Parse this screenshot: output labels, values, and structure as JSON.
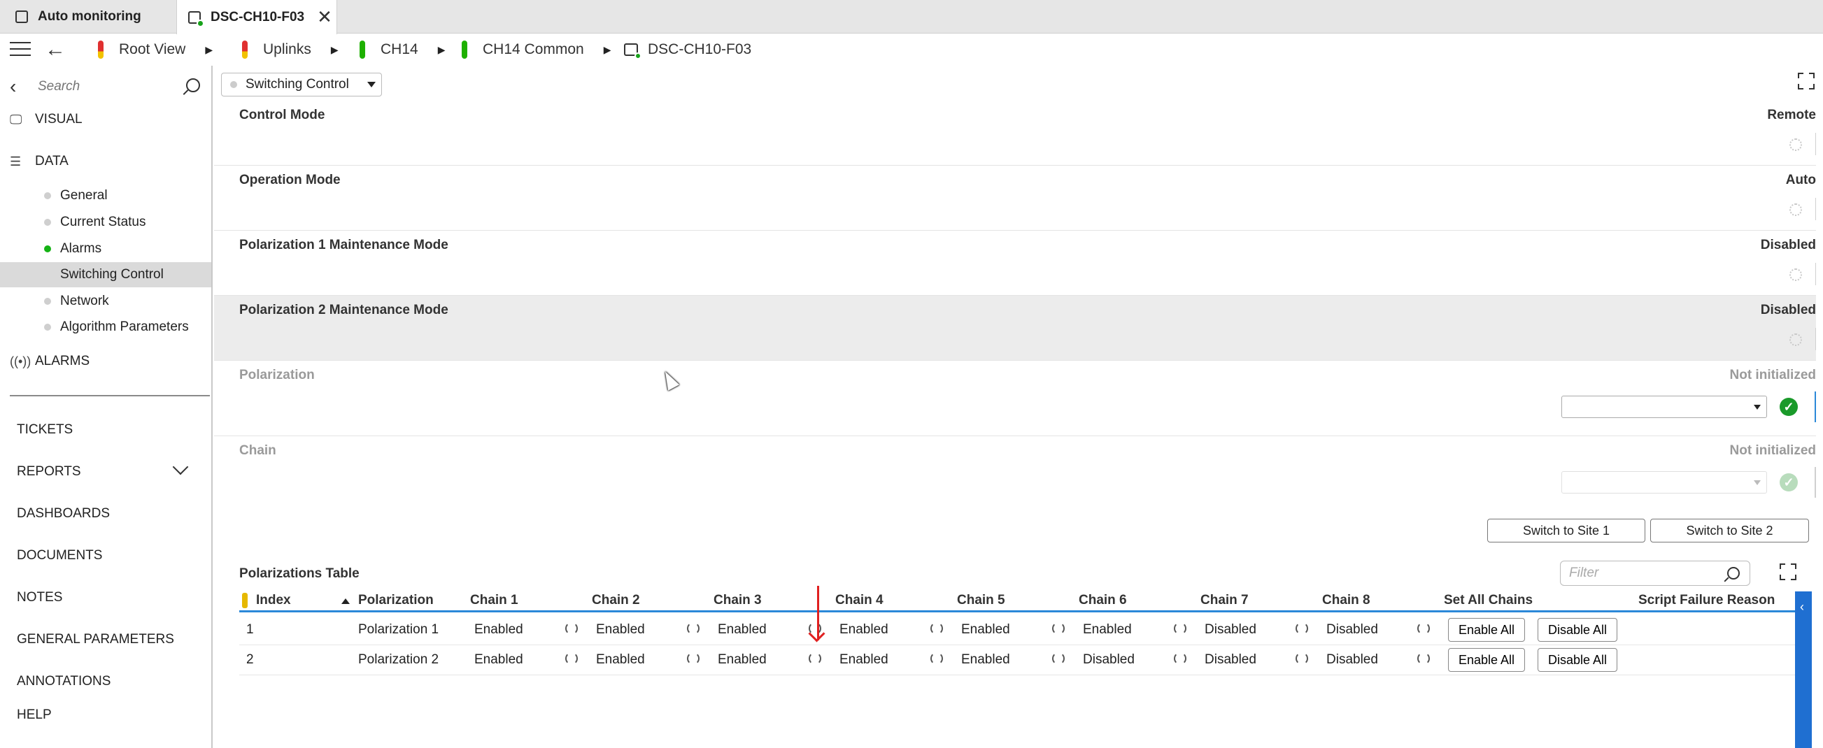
{
  "tabs": [
    {
      "label": "Auto monitoring"
    },
    {
      "label": "DSC-CH10-F03"
    }
  ],
  "breadcrumb": [
    {
      "label": "Root View",
      "status": "alarm"
    },
    {
      "label": "Uplinks",
      "status": "alarm"
    },
    {
      "label": "CH14",
      "status": "ok"
    },
    {
      "label": "CH14 Common",
      "status": "ok"
    },
    {
      "label": "DSC-CH10-F03",
      "status": "device"
    }
  ],
  "sidebar": {
    "search_placeholder": "Search",
    "visual": "VISUAL",
    "data": "DATA",
    "items": [
      {
        "label": "General",
        "bullet": "grey"
      },
      {
        "label": "Current Status",
        "bullet": "grey"
      },
      {
        "label": "Alarms",
        "bullet": "green"
      },
      {
        "label": "Switching Control",
        "bullet": "none",
        "active": true
      },
      {
        "label": "Network",
        "bullet": "grey"
      },
      {
        "label": "Algorithm Parameters",
        "bullet": "grey"
      }
    ],
    "alarms": "ALARMS",
    "links": [
      "TICKETS",
      "REPORTS",
      "DASHBOARDS",
      "DOCUMENTS",
      "NOTES",
      "GENERAL PARAMETERS",
      "ANNOTATIONS",
      "HELP"
    ]
  },
  "view_selector": "Switching Control",
  "params": [
    {
      "name": "Control Mode",
      "value": "Remote"
    },
    {
      "name": "Operation Mode",
      "value": "Auto"
    },
    {
      "name": "Polarization 1 Maintenance Mode",
      "value": "Disabled"
    },
    {
      "name": "Polarization 2 Maintenance Mode",
      "value": "Disabled"
    },
    {
      "name": "Polarization",
      "value": "Not initialized"
    },
    {
      "name": "Chain",
      "value": "Not initialized"
    }
  ],
  "buttons": {
    "site1": "Switch to Site 1",
    "site2": "Switch to Site 2"
  },
  "table": {
    "title": "Polarizations Table",
    "filter_placeholder": "Filter",
    "headers": [
      "Index",
      "Polarization",
      "Chain 1",
      "Chain 2",
      "Chain 3",
      "Chain 4",
      "Chain 5",
      "Chain 6",
      "Chain 7",
      "Chain 8",
      "Set All Chains",
      "Script Failure Reason"
    ],
    "rows": [
      {
        "index": "1",
        "polarization": "Polarization 1",
        "chains": [
          "Enabled",
          "Enabled",
          "Enabled",
          "Enabled",
          "Enabled",
          "Enabled",
          "Disabled",
          "Disabled"
        ],
        "enable_all": "Enable All",
        "disable_all": "Disable All"
      },
      {
        "index": "2",
        "polarization": "Polarization 2",
        "chains": [
          "Enabled",
          "Enabled",
          "Enabled",
          "Enabled",
          "Enabled",
          "Disabled",
          "Disabled",
          "Disabled"
        ],
        "enable_all": "Enable All",
        "disable_all": "Disable All"
      }
    ]
  },
  "colors": {
    "accent": "#2b88d8",
    "alarm_red": "#e03030",
    "ok_green": "#1eb000",
    "arrow": "#e02020"
  }
}
